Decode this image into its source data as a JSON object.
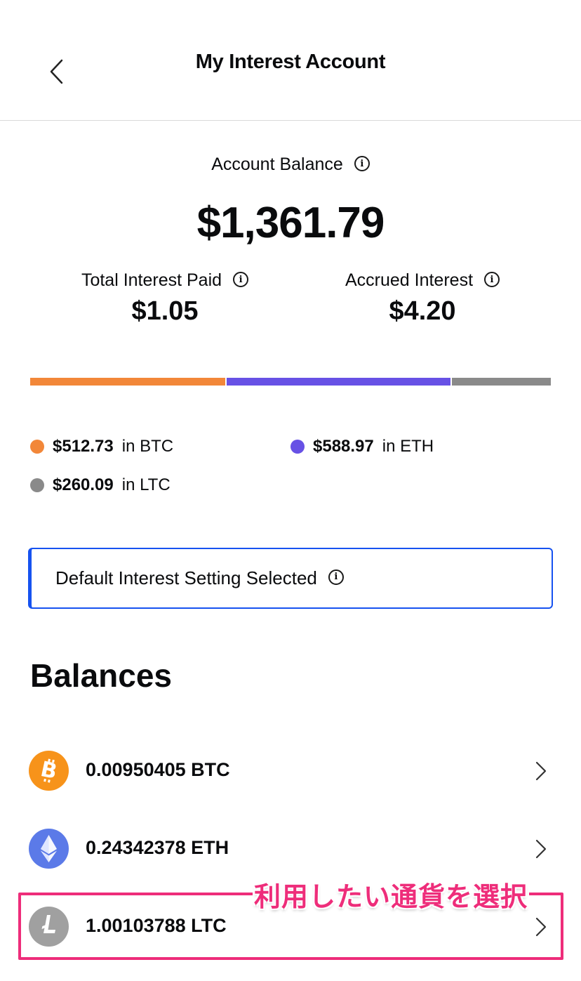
{
  "header": {
    "title": "My Interest Account"
  },
  "account": {
    "label": "Account Balance",
    "value": "$1,361.79",
    "total_interest_label": "Total Interest Paid",
    "total_interest_value": "$1.05",
    "accrued_label": "Accrued Interest",
    "accrued_value": "$4.20"
  },
  "allocation": [
    {
      "coin": "BTC",
      "amount": "$512.73",
      "suffix": "in BTC",
      "value": 512.73,
      "color": "#f28739"
    },
    {
      "coin": "ETH",
      "amount": "$588.97",
      "suffix": "in ETH",
      "value": 588.97,
      "color": "#6751e5"
    },
    {
      "coin": "LTC",
      "amount": "$260.09",
      "suffix": "in LTC",
      "value": 260.09,
      "color": "#8a8a8a"
    }
  ],
  "setting": {
    "label": "Default Interest Setting Selected"
  },
  "balances": {
    "title": "Balances",
    "rows": [
      {
        "amount": "0.00950405 BTC",
        "icon": "bitcoin-icon",
        "color": "#f7931a"
      },
      {
        "amount": "0.24342378 ETH",
        "icon": "ethereum-icon",
        "color": "#5b7ae8"
      },
      {
        "amount": "1.00103788 LTC",
        "icon": "litecoin-icon",
        "color": "#a0a0a0"
      }
    ]
  },
  "annotation": {
    "text": "利用したい通貨を選択",
    "color": "#ee2d7a"
  },
  "accent_color": "#1652f0"
}
